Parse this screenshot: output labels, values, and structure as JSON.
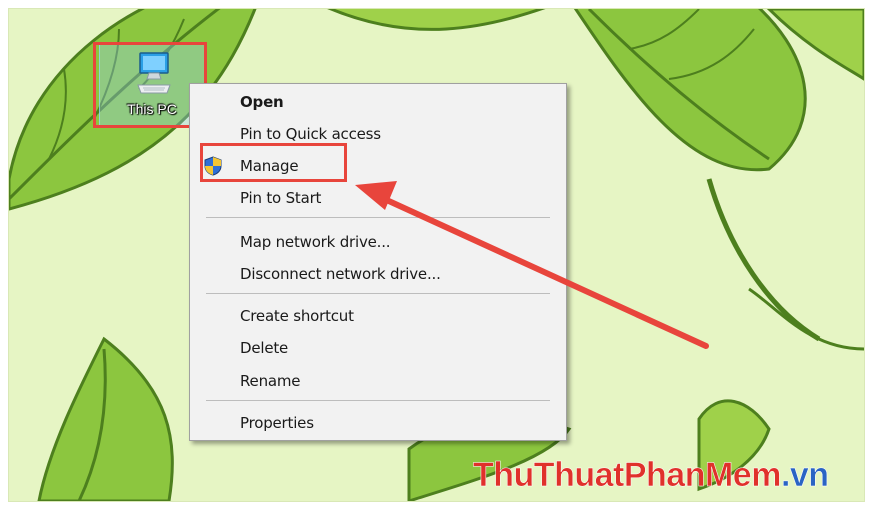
{
  "desktop": {
    "icon_label": "This PC",
    "icon_name": "computer-icon"
  },
  "context_menu": {
    "items": [
      {
        "label": "Open",
        "bold": true
      },
      {
        "label": "Pin to Quick access"
      },
      {
        "label": "Manage",
        "icon": "uac-shield-icon"
      },
      {
        "label": "Pin to Start"
      },
      {
        "label": "Map network drive..."
      },
      {
        "label": "Disconnect network drive..."
      },
      {
        "label": "Create shortcut"
      },
      {
        "label": "Delete"
      },
      {
        "label": "Rename"
      },
      {
        "label": "Properties"
      }
    ]
  },
  "annotation": {
    "highlight_color": "#e8453c",
    "arrow_color": "#e8453c"
  },
  "watermark": {
    "part1": "ThuThuat",
    "part2": "PhanMem",
    "part3": ".vn",
    "colors": {
      "red": "#e0312b",
      "blue": "#2a64c4"
    }
  },
  "wallpaper": {
    "background_color": "#e6f5c4",
    "leaf_color": "#8cc63f",
    "vein_color": "#4d7f1e"
  }
}
